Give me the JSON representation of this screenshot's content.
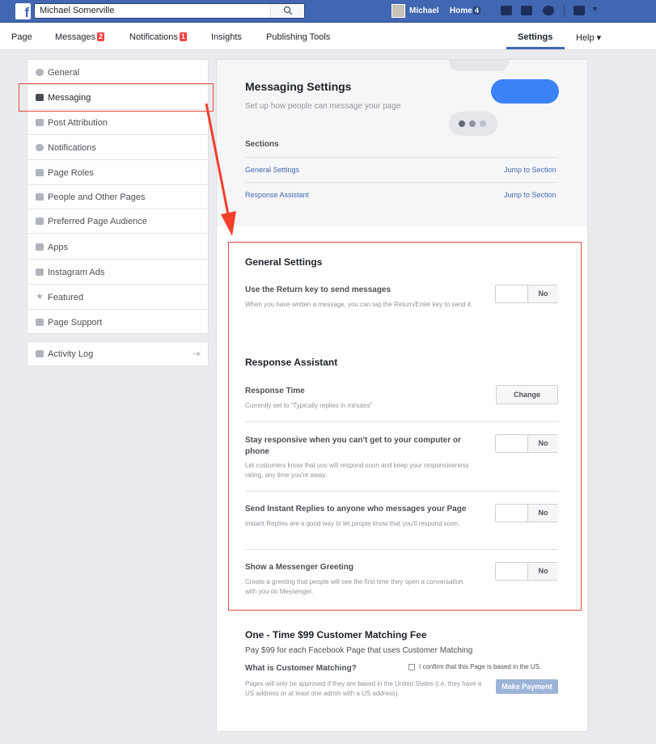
{
  "topbar": {
    "search_value": "Michael  Somerville",
    "user_name": "Michael",
    "home_label": "Home",
    "home_count": "4"
  },
  "pagenav": {
    "page": "Page",
    "messages": "Messages",
    "messages_count": "2",
    "notifications": "Notifications",
    "notifications_count": "1",
    "insights": "Insights",
    "publishing_tools": "Publishing Tools",
    "settings": "Settings",
    "help": "Help ▾"
  },
  "sidebar": {
    "items": [
      {
        "label": "General",
        "icon": "gear-icon"
      },
      {
        "label": "Messaging",
        "icon": "chat-icon"
      },
      {
        "label": "Post Attribution",
        "icon": "flag-icon"
      },
      {
        "label": "Notifications",
        "icon": "globe-icon"
      },
      {
        "label": "Page Roles",
        "icon": "person-icon"
      },
      {
        "label": "People and Other Pages",
        "icon": "people-icon"
      },
      {
        "label": "Preferred Page Audience",
        "icon": "people-icon"
      },
      {
        "label": "Apps",
        "icon": "cube-icon"
      },
      {
        "label": "Instagram Ads",
        "icon": "instagram-icon"
      },
      {
        "label": "Featured",
        "icon": "star-icon"
      },
      {
        "label": "Page Support",
        "icon": "facebook-icon"
      }
    ],
    "activity_log": "Activity Log"
  },
  "header": {
    "title": "Messaging Settings",
    "subtitle": "Set up how people can message your page",
    "sections_label": "Sections",
    "sections": [
      {
        "name": "General Settings",
        "jump": "Jump to Section"
      },
      {
        "name": "Response Assistant",
        "jump": "Jump to Section"
      }
    ]
  },
  "general": {
    "title": "General Settings",
    "return_key_label": "Use the Return key to send messages",
    "return_key_desc": "When you have written a message, you can tap the Return/Enter key to send it.",
    "return_key_value": "No"
  },
  "response": {
    "title": "Response Assistant",
    "time_label": "Response Time",
    "time_desc": "Currently set to \"Typically replies in minutes\"",
    "time_button": "Change",
    "stay_label": "Stay responsive when you can't get to your computer or phone",
    "stay_desc": "Let customers know that you will respond soon and keep your responsiveness rating, any time you're away.",
    "stay_value": "No",
    "instant_label": "Send Instant Replies to anyone who messages your Page",
    "instant_desc": "Instant Replies are a good way to let people know that you'll respond soon.",
    "instant_value": "No",
    "greeting_label": "Show a Messenger Greeting",
    "greeting_desc": "Create a greeting that people will see the first time they open a conversation with you on Messenger.",
    "greeting_value": "No"
  },
  "matching": {
    "title": "One - Time $99 Customer Matching Fee",
    "subtitle": "Pay $99 for each Facebook Page that uses Customer Matching",
    "question": "What is Customer Matching?",
    "confirm": "I confirm that this Page is based in the US.",
    "note": "Pages will only be approved if they are based in the United States (i.e. they have a US address or at least one admin with a US address).",
    "pay_button": "Make Payment"
  },
  "colors": {
    "brand": "#4267b2",
    "annotation": "#e74c3c",
    "messenger_blue": "#3b82f6"
  }
}
